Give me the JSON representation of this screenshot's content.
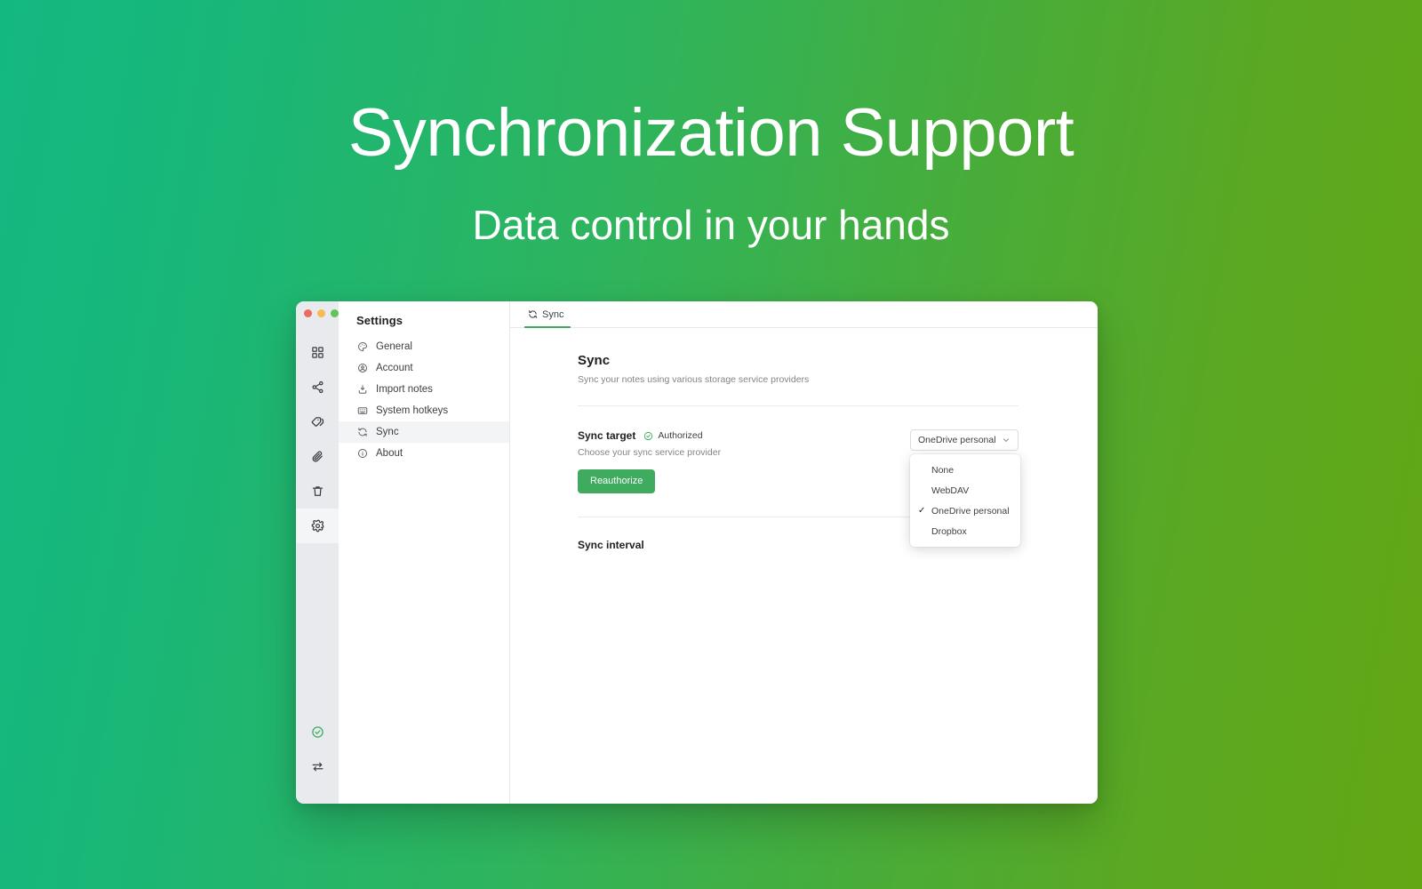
{
  "hero": {
    "title": "Synchronization Support",
    "subtitle": "Data control in your hands"
  },
  "theme": {
    "gradient_start": "#13b881",
    "gradient_end": "#63a714",
    "accent_green": "#3eab5f",
    "text_primary": "#202124",
    "text_muted": "#80868b"
  },
  "window": {
    "traffic_lights": [
      {
        "name": "close",
        "color": "#ec6a5e"
      },
      {
        "name": "minimize",
        "color": "#f4bd4f"
      },
      {
        "name": "zoom",
        "color": "#61c454"
      }
    ],
    "rail": {
      "items": [
        {
          "icon": "grid-icon",
          "label": "Dashboard",
          "active": false
        },
        {
          "icon": "share-icon",
          "label": "Share",
          "active": false
        },
        {
          "icon": "tags-icon",
          "label": "Tags",
          "active": false
        },
        {
          "icon": "paperclip-icon",
          "label": "Attachments",
          "active": false
        },
        {
          "icon": "trash-icon",
          "label": "Trash",
          "active": false
        },
        {
          "icon": "gear-icon",
          "label": "Settings",
          "active": true
        }
      ],
      "bottom_items": [
        {
          "icon": "check-circle-icon",
          "label": "Status OK"
        },
        {
          "icon": "sync-arrows-icon",
          "label": "Sync now"
        }
      ]
    },
    "settings": {
      "title": "Settings",
      "items": [
        {
          "label": "General",
          "icon": "palette-icon",
          "active": false
        },
        {
          "label": "Account",
          "icon": "account-icon",
          "active": false
        },
        {
          "label": "Import notes",
          "icon": "import-icon",
          "active": false
        },
        {
          "label": "System hotkeys",
          "icon": "keyboard-icon",
          "active": false
        },
        {
          "label": "Sync",
          "icon": "sync-icon",
          "active": true
        },
        {
          "label": "About",
          "icon": "info-icon",
          "active": false
        }
      ]
    },
    "tabs": [
      {
        "label": "Sync",
        "icon": "sync-icon",
        "active": true
      }
    ],
    "pane": {
      "heading": "Sync",
      "description": "Sync your notes using various storage service providers",
      "sync_target": {
        "label": "Sync target",
        "status": "Authorized",
        "status_icon": "check-circle-icon",
        "sub": "Choose your sync service provider",
        "button": "Reauthorize",
        "select": {
          "value": "OneDrive personal",
          "options": [
            {
              "label": "None",
              "selected": false
            },
            {
              "label": "WebDAV",
              "selected": false
            },
            {
              "label": "OneDrive personal",
              "selected": true
            },
            {
              "label": "Dropbox",
              "selected": false
            }
          ],
          "check_glyph": "✓"
        }
      },
      "sync_interval": {
        "label": "Sync interval"
      }
    }
  }
}
